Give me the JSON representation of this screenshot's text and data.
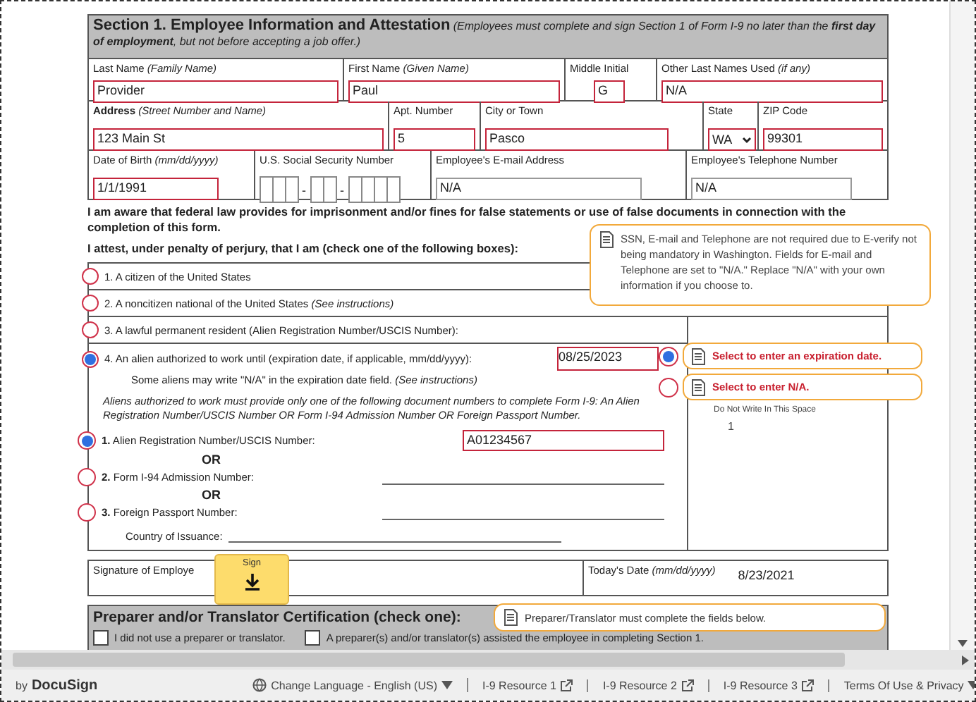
{
  "header": {
    "title": "Section 1. Employee Information and Attestation",
    "note": "(Employees must complete and sign Section 1 of Form I-9 no later than the **first day of employment**, but not before accepting a job offer.)"
  },
  "field_rows": [
    {
      "fields": [
        {
          "label": "Last Name *(Family Name)*",
          "kind": "text",
          "value": "Provider",
          "required": true
        },
        {
          "label": "First Name *(Given Name)*",
          "kind": "text",
          "value": "Paul",
          "required": true
        },
        {
          "label": "Middle Initial",
          "kind": "text",
          "value": "G",
          "required": true
        },
        {
          "label": "Other Last Names Used *(if any)*",
          "kind": "text",
          "value": "N/A",
          "required": true
        }
      ]
    },
    {
      "fields": [
        {
          "label": "**Address** *(Street Number and Name)*",
          "kind": "text",
          "value": "123 Main St",
          "required": true
        },
        {
          "label": "Apt. Number",
          "kind": "text",
          "value": "5",
          "required": true
        },
        {
          "label": "City or Town",
          "kind": "text",
          "value": "Pasco",
          "required": true
        },
        {
          "label": "State",
          "kind": "select",
          "value": "WA",
          "required": true
        },
        {
          "label": "ZIP Code",
          "kind": "text",
          "value": "99301",
          "required": true
        }
      ]
    },
    {
      "fields": [
        {
          "label": "Date of Birth *(mm/dd/yyyy)*",
          "kind": "text",
          "value": "1/1/1991",
          "required": true
        },
        {
          "label": "U.S. Social Security Number",
          "kind": "ssn",
          "separators": [
            "-",
            "-"
          ],
          "required": false
        },
        {
          "label": "Employee's E-mail Address",
          "kind": "text",
          "value": "N/A",
          "required": false
        },
        {
          "label": "Employee's Telephone Number",
          "kind": "text",
          "value": "N/A",
          "required": false
        }
      ]
    }
  ],
  "attestation": {
    "paragraphs": [
      "I am aware that federal law provides for imprisonment and/or fines for false statements or use of false documents in connection with the completion of this form.",
      "I attest, under penalty of perjury, that I am (check one of the following boxes):"
    ],
    "options": [
      {
        "label": "1. A citizen of the United States",
        "selected": false
      },
      {
        "label": "2. A noncitizen national of the United States *(See instructions)*",
        "selected": false
      },
      {
        "label": "3. A lawful permanent resident     (Alien Registration Number/USCIS Number):",
        "selected": false
      },
      {
        "label": "4. An alien authorized to work     until (expiration date, if applicable, mm/dd/yyyy):",
        "value": "08/25/2023",
        "note": "Some aliens may write \"N/A\" in the expiration date field. *(See instructions)*",
        "selected": true
      }
    ],
    "side_column": {
      "heading": "Do Not Write In This Space",
      "value": "1"
    }
  },
  "expiration_choices": [
    {
      "label": "Select to enter an expiration date.",
      "selected": true
    },
    {
      "label": "Select to enter N/A.",
      "selected": false
    }
  ],
  "documents": {
    "note": "Aliens authorized to work must provide only one of the following document numbers to complete Form I-9: An Alien Registration Number/USCIS Number OR Form I-94 Admission Number OR Foreign Passport Number.",
    "items": [
      {
        "label": "**1.** Alien Registration Number/USCIS Number:",
        "kind": "input",
        "value": "A01234567",
        "selected": true,
        "separator": "OR"
      },
      {
        "label": "**2.** Form I-94 Admission Number:",
        "kind": "line",
        "selected": false,
        "separator": "OR"
      },
      {
        "label": "**3.** Foreign Passport Number:",
        "kind": "line",
        "selected": false
      }
    ],
    "country_label": "Country of Issuance:"
  },
  "signature": {
    "label": "Signature of Employe",
    "button": "Sign",
    "date_label": "Today's Date *(mm/dd/yyyy)*",
    "date": "8/23/2021"
  },
  "info_tip": "SSN, E-mail and Telephone are not required due to E-verify not being mandatory in Washington. Fields for E-mail and Telephone are set to \"N/A.\" Replace \"N/A\" with your own information if you choose to.",
  "preparer": {
    "title": "Preparer and/or Translator Certification (check one):",
    "tip": "Preparer/Translator must complete the fields below.",
    "options": [
      {
        "label": "I did not use a preparer or translator.",
        "checked": false
      },
      {
        "label": "A preparer(s) and/or translator(s) assisted the employee in completing Section 1.",
        "checked": false
      }
    ]
  },
  "footer": {
    "brand_prefix": "by",
    "brand": "DocuSign",
    "links": [
      {
        "label": "Change Language - English (US)",
        "kind": "language"
      },
      {
        "label": "I-9 Resource 1",
        "kind": "external"
      },
      {
        "label": "I-9 Resource 2",
        "kind": "external"
      },
      {
        "label": "I-9 Resource 3",
        "kind": "external"
      },
      {
        "label": "Terms Of Use & Privacy",
        "kind": "dropdown"
      }
    ]
  }
}
